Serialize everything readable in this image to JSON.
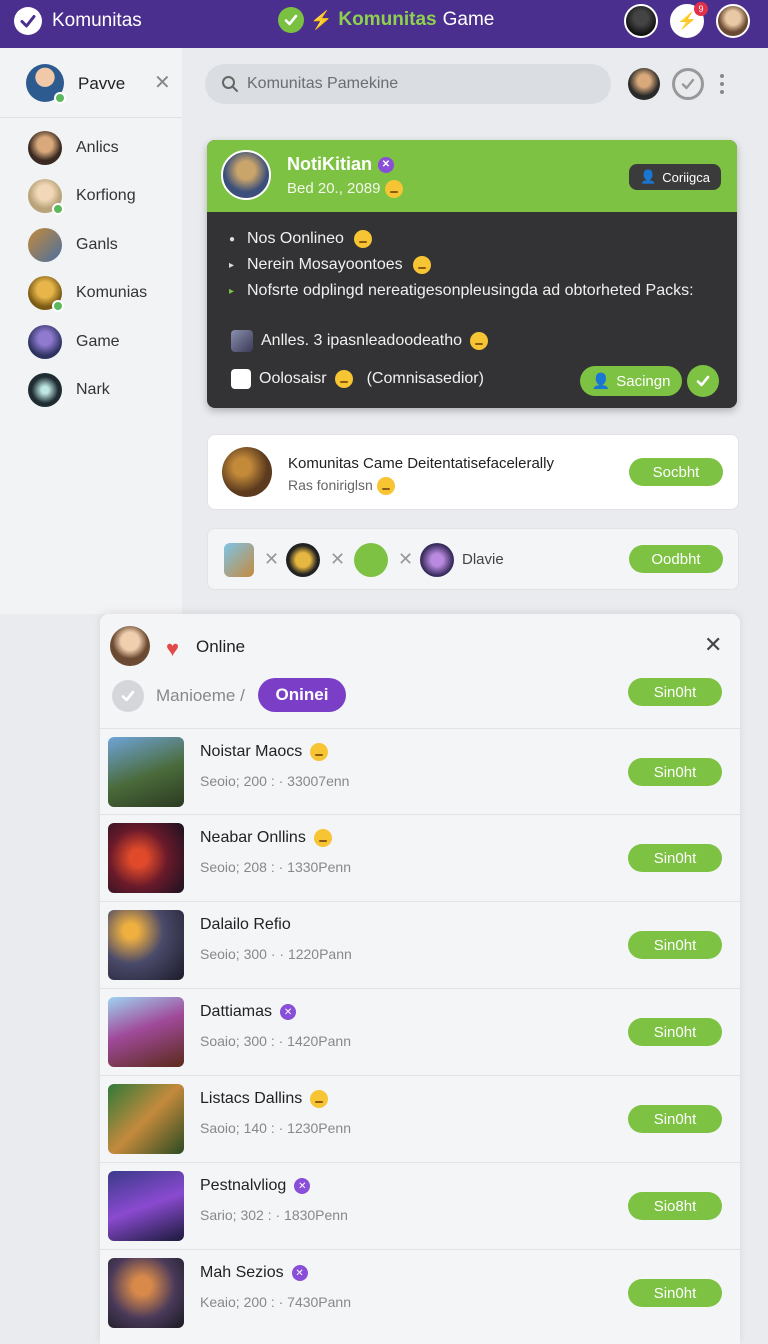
{
  "topbar": {
    "app_name": "Komunitas",
    "center_title_part1": "Komunitas",
    "center_title_part2": "Game",
    "badge_count": "9"
  },
  "sidebar": {
    "user_name": "Pavve",
    "items": [
      {
        "label": "Anlics"
      },
      {
        "label": "Korfiong"
      },
      {
        "label": "Ganls"
      },
      {
        "label": "Komunias"
      },
      {
        "label": "Game"
      },
      {
        "label": "Nark"
      }
    ]
  },
  "search": {
    "placeholder": "Komunitas Pamekine"
  },
  "notification": {
    "title": "NotiKitian",
    "date": "Bed 20., 2089",
    "config_label": "Coriigca",
    "bullets": [
      "Nos Oonlineo",
      "Nerein Mosayoontoes",
      "Nofsrte odplingd nereatigesonpleusingda ad obtorheted Packs:"
    ],
    "line1": "Anlles. 3 ipasnleadoodeatho",
    "line2": "Oolosaisr",
    "line2_paren": "(Comnisasedior)",
    "signin_label": "Sacingn"
  },
  "card1": {
    "title": "Komunitas Came Deitentatisefacelerally",
    "subtitle": "Ras foniriglsn",
    "button": "Socbht"
  },
  "card2": {
    "name": "Dlavie",
    "button": "Oodbht"
  },
  "panel": {
    "title": "Online",
    "sub": "Manioeme",
    "pill": "Oninei",
    "top_button": "Sin0ht",
    "games": [
      {
        "name": "Noistar Maocs",
        "meta": "Seoio; 200 :  ·  33007enn",
        "button": "Sin0ht",
        "badge": "emoji"
      },
      {
        "name": "Neabar Onllins",
        "meta": "Seoio; 208 :  ·  1330Penn",
        "button": "Sin0ht",
        "badge": "emoji"
      },
      {
        "name": "Dalailo Refio",
        "meta": "Seoio; 300 ·  ·  1220Pann",
        "button": "Sin0ht",
        "badge": "none"
      },
      {
        "name": "Dattiamas",
        "meta": "Soaio; 300 :  ·  1420Pann",
        "button": "Sin0ht",
        "badge": "purple"
      },
      {
        "name": "Listacs Dallins",
        "meta": "Saoio; 140 :  ·  1230Penn",
        "button": "Sin0ht",
        "badge": "emoji"
      },
      {
        "name": "Pestnalvliog",
        "meta": "Sario; 302 :  ·  1830Penn",
        "button": "Sio8ht",
        "badge": "purple"
      },
      {
        "name": "Mah Sezios",
        "meta": "Keaio; 200 :  ·  7430Pann",
        "button": "Sin0ht",
        "badge": "purple"
      }
    ]
  },
  "colors": {
    "topbar": "#4a2f8f",
    "accent_green": "#7dc242",
    "accent_purple": "#7b3fc7"
  }
}
